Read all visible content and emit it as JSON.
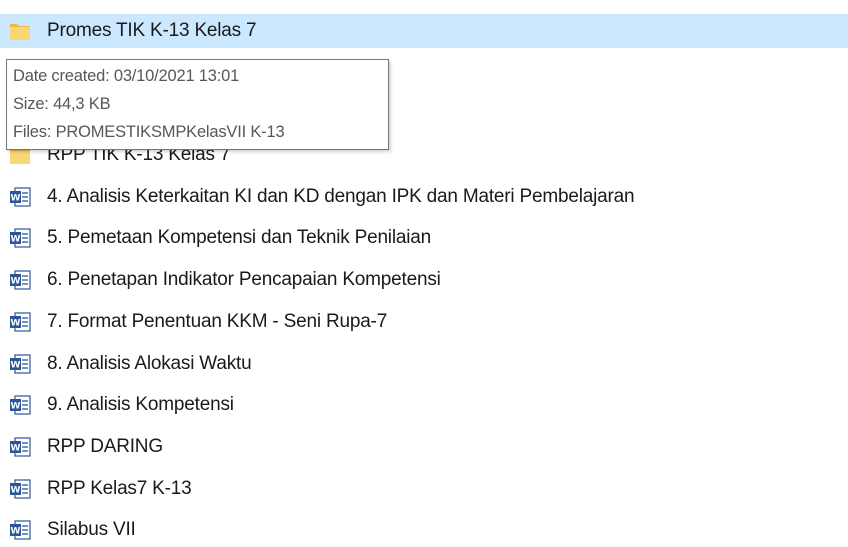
{
  "items": [
    {
      "name": "Promes TIK K-13 Kelas 7",
      "type": "folder",
      "icon": "folder-icon",
      "selected": true
    },
    {
      "name": "RPP TIK K-13 Kelas 7",
      "type": "folder",
      "icon": "folder-icon",
      "selected": false
    },
    {
      "name": "4. Analisis Keterkaitan KI dan KD dengan IPK dan Materi Pembelajaran",
      "type": "document",
      "icon": "word-document-icon",
      "selected": false
    },
    {
      "name": "5. Pemetaan Kompetensi dan Teknik Penilaian",
      "type": "document",
      "icon": "word-document-icon",
      "selected": false
    },
    {
      "name": "6. Penetapan Indikator Pencapaian Kompetensi",
      "type": "document",
      "icon": "word-document-icon",
      "selected": false
    },
    {
      "name": "7. Format Penentuan KKM - Seni Rupa-7",
      "type": "document",
      "icon": "word-document-icon",
      "selected": false
    },
    {
      "name": "8. Analisis Alokasi Waktu",
      "type": "document",
      "icon": "word-document-icon",
      "selected": false
    },
    {
      "name": "9. Analisis Kompetensi",
      "type": "document",
      "icon": "word-document-icon",
      "selected": false
    },
    {
      "name": "RPP DARING",
      "type": "document",
      "icon": "word-document-icon",
      "selected": false
    },
    {
      "name": "RPP Kelas7 K-13",
      "type": "document",
      "icon": "word-document-icon",
      "selected": false
    },
    {
      "name": "Silabus VII",
      "type": "document",
      "icon": "word-document-icon",
      "selected": false
    }
  ],
  "tooltip": {
    "date_created": "Date created: 03/10/2021 13:01",
    "size": "Size: 44,3 KB",
    "files": "Files: PROMESTIKSMPKelasVII K-13"
  },
  "colors": {
    "selection": "#cce8ff",
    "folder": "#f8d775",
    "word_blue": "#2b579a"
  }
}
